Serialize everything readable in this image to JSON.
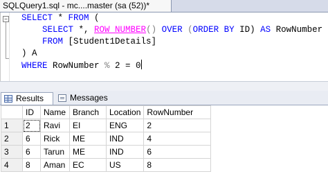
{
  "document_tab": {
    "title": "SQLQuery1.sql - mc....master (sa (52))*"
  },
  "editor": {
    "collapse_symbol": "−",
    "line1": {
      "kw1": "SELECT",
      "mid": " * ",
      "kw2": "FROM",
      "tail": " ("
    },
    "line2": {
      "kw1": "SELECT",
      "mid1": " *, ",
      "fn": "ROW_NUMBER",
      "paren": "() ",
      "kw2": "OVER",
      "mid2": " (",
      "kw3": "ORDER BY",
      "mid3": " ID) ",
      "kw4": "AS",
      "tail": " RowNumber"
    },
    "line3": {
      "kw1": "FROM",
      "tail": " [Student1Details]"
    },
    "line4": {
      "text": ") A"
    },
    "line5": {
      "kw1": "WHERE",
      "mid": " RowNumber ",
      "op": "%",
      "tail": " 2 = 0"
    }
  },
  "results_tabs": {
    "results": "Results",
    "messages": "Messages"
  },
  "grid": {
    "columns": [
      "ID",
      "Name",
      "Branch",
      "Location",
      "RowNumber"
    ],
    "rows": [
      {
        "n": "1",
        "id": "2",
        "name": "Ravi",
        "branch": "EI",
        "location": "ENG",
        "rownumber": "2"
      },
      {
        "n": "2",
        "id": "6",
        "name": "Rick",
        "branch": "ME",
        "location": "IND",
        "rownumber": "4"
      },
      {
        "n": "3",
        "id": "6",
        "name": "Tarun",
        "branch": "ME",
        "location": "IND",
        "rownumber": "6"
      },
      {
        "n": "4",
        "id": "8",
        "name": "Aman",
        "branch": "EC",
        "location": "US",
        "rownumber": "8"
      }
    ]
  }
}
